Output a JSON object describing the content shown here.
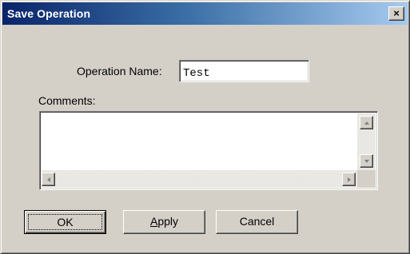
{
  "window": {
    "title": "Save Operation",
    "close_glyph": "×"
  },
  "form": {
    "operation_name_label": "Operation Name:",
    "operation_name_value": "Test",
    "comments_label": "Comments:",
    "comments_value": ""
  },
  "buttons": {
    "ok_label": "OK",
    "apply_label": "Apply",
    "apply_mnemonic": "A",
    "apply_rest": "pply",
    "cancel_label": "Cancel"
  },
  "colors": {
    "face": "#d4d0c8",
    "title_active_start": "#0a246a",
    "title_active_end": "#a6caf0",
    "field_bg": "#ffffff"
  },
  "icons": {
    "close": "close-icon",
    "scroll_up": "scroll-up-arrow-icon",
    "scroll_down": "scroll-down-arrow-icon",
    "scroll_left": "scroll-left-arrow-icon",
    "scroll_right": "scroll-right-arrow-icon"
  }
}
